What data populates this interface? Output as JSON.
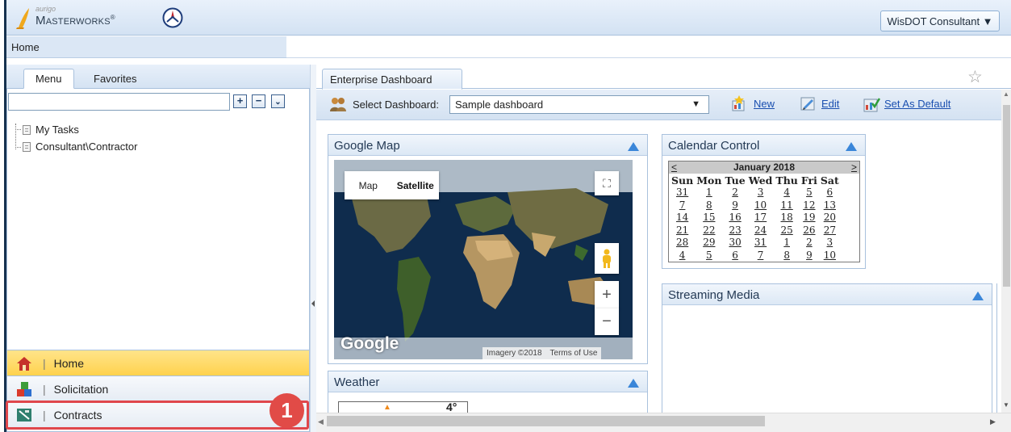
{
  "header": {
    "brand_small": "aurigo",
    "brand_prefix": "Masterworks",
    "user_menu": "WisDOT Consultant ▼",
    "breadcrumb": "Home"
  },
  "left_panel": {
    "tabs": [
      "Menu",
      "Favorites"
    ],
    "tree": [
      "My Tasks",
      "Consultant\\Contractor"
    ],
    "nav": [
      {
        "label": "Home",
        "icon": "house-icon"
      },
      {
        "label": "Solicitation",
        "icon": "blocks-icon"
      },
      {
        "label": "Contracts",
        "icon": "contract-icon"
      }
    ],
    "callout_number": "1"
  },
  "dashboard": {
    "tab": "Enterprise Dashboard",
    "select_label": "Select Dashboard:",
    "selected": "Sample dashboard",
    "new_label": "New",
    "edit_label": "Edit",
    "default_label": "Set As Default"
  },
  "portlets": {
    "google_map": {
      "title": "Google Map",
      "map_label": "Map",
      "satellite_label": "Satellite",
      "logo": "Google",
      "imagery": "Imagery ©2018",
      "terms": "Terms of Use"
    },
    "calendar": {
      "title": "Calendar Control",
      "prev": "<",
      "next": ">",
      "month": "January 2018",
      "days": [
        "Sun",
        "Mon",
        "Tue",
        "Wed",
        "Thu",
        "Fri",
        "Sat"
      ],
      "weeks": [
        [
          "31",
          "1",
          "2",
          "3",
          "4",
          "5",
          "6"
        ],
        [
          "7",
          "8",
          "9",
          "10",
          "11",
          "12",
          "13"
        ],
        [
          "14",
          "15",
          "16",
          "17",
          "18",
          "19",
          "20"
        ],
        [
          "21",
          "22",
          "23",
          "24",
          "25",
          "26",
          "27"
        ],
        [
          "28",
          "29",
          "30",
          "31",
          "1",
          "2",
          "3"
        ],
        [
          "4",
          "5",
          "6",
          "7",
          "8",
          "9",
          "10"
        ]
      ]
    },
    "streaming": {
      "title": "Streaming Media"
    },
    "weather": {
      "title": "Weather",
      "reading": "4°"
    }
  },
  "colors": {
    "accent": "#3a86d9",
    "highlight": "#e0474c",
    "home_nav": "#ffd24d"
  }
}
